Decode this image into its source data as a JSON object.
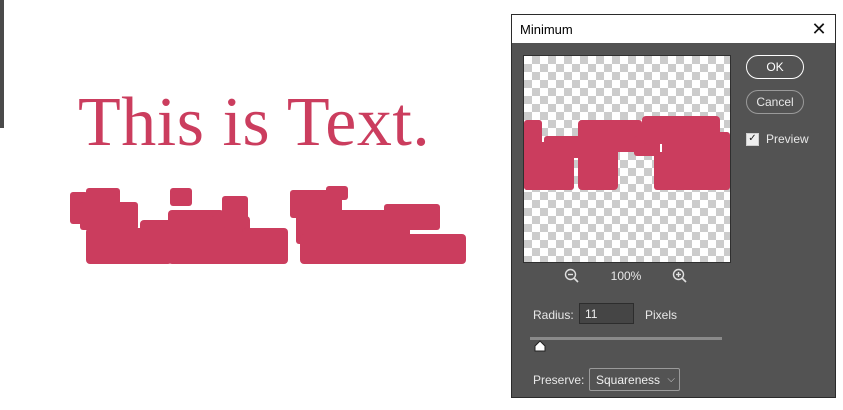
{
  "canvas": {
    "sample_text": "This is Text.",
    "text_color": "#cb3d5e"
  },
  "dialog": {
    "title": "Minimum",
    "close_icon": "close-icon",
    "buttons": {
      "ok": "OK",
      "cancel": "Cancel"
    },
    "preview_checkbox": {
      "label": "Preview",
      "checked": true
    },
    "zoom": {
      "level": "100%",
      "zoom_out_icon": "zoom-out-icon",
      "zoom_in_icon": "zoom-in-icon"
    },
    "radius": {
      "label": "Radius:",
      "value": "11",
      "unit": "Pixels",
      "slider_position": 0.05
    },
    "preserve": {
      "label": "Preserve:",
      "value": "Squareness"
    },
    "colors": {
      "dialog_bg": "#535353",
      "accent_shape": "#cb3d5e"
    }
  }
}
